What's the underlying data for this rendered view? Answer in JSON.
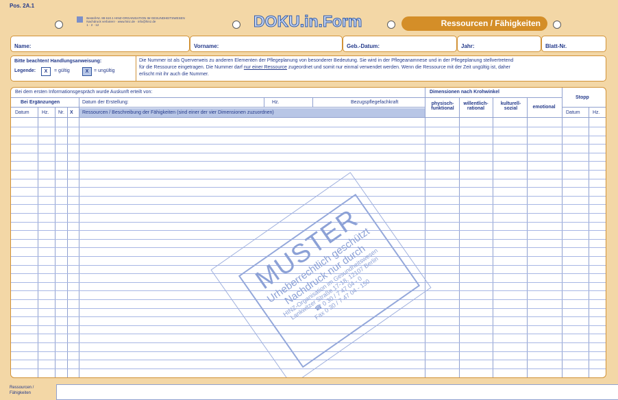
{
  "page": {
    "pos": "Pos. 2A.1",
    "publisher_lines": [
      "Bestell-Nr. 88 610.1 HINZ-ORGANISATION IM GESUNDHEITSWESEN",
      "Nachdruck verboten! · www.hinz.de · info@hinz.de",
      "1 · 2 · 12"
    ],
    "brand": "DOKU.in.Form",
    "section_tag": "Ressourcen / Fähigkeiten",
    "fields": [
      "Name:",
      "Vorname:",
      "Geb.-Datum:",
      "Jahr:",
      "Blatt-Nr."
    ],
    "note": {
      "title": "Bitte beachten! Handlungsanweisung:",
      "legend_label": "Legende:",
      "legend_x": "X",
      "legend_valid": "= gültig",
      "legend_invalid": "= ungültig",
      "text_1": "Die Nummer ist als Querverweis zu anderen Elementen der Pflegeplanung von besonderer Bedeutung. Sie wird in der Pflegeanamnese und in der Pflegeplanung stellvertretend",
      "text_2_a": "für die Ressource eingetragen. Die Nummer darf ",
      "text_2_u": "nur einer Ressource",
      "text_2_b": " zugeordnet und somit nur einmal verwendet werden. Wenn die Ressource mit der Zeit ungültig ist, daher",
      "text_3": "erlischt mit ihr auch die Nummer."
    },
    "table": {
      "info_row": "Bei dem ersten Informationsgespräch wurde Auskunft erteilt von:",
      "dimensions_title": "Dimensionen nach Krohwinkel",
      "stopp": "Stopp",
      "bei_ergaenzungen": "Bei Ergänzungen",
      "datum_erstellung": "Datum der Erstellung:",
      "hz": "Hz.",
      "bezugspflegefachkraft": "Bezugspflegefachkraft",
      "dim_cols": [
        "physisch-\nfunktional",
        "willentlich-\nrational",
        "kulturell-\nsozial",
        "emotional"
      ],
      "col_datum": "Datum",
      "col_hz": "Hz.",
      "col_nr": "Nr.",
      "col_x": "X",
      "col_ressourcen": "Ressourcen / Beschreibung der Fähigkeiten (sind einer der vier Dimensionen zuzuordnen)",
      "stopp_datum": "Datum",
      "stopp_hz": "Hz."
    },
    "stamp": {
      "big": "MUSTER",
      "l1": "Urheberrechtlich geschützt",
      "l2": "Nachdruck nur durch",
      "l3": "HINZ-Organisation im Gesundheitswesen",
      "l4": "Lankwitzer Straße 17-18, 12107 Berlin",
      "l5": "☎ 0 30 / 7 47 04 - 0",
      "l6": "Fax 0 30 / 7 47 04 - 150"
    },
    "bottom_label": "Ressourcen /\nFähigkeiten"
  }
}
